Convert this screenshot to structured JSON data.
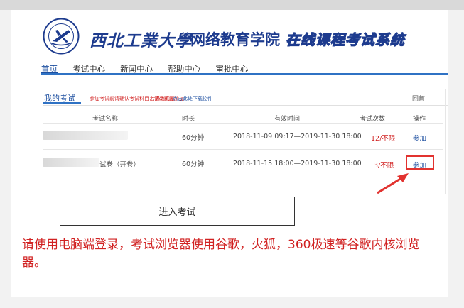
{
  "header": {
    "school_name": "西北工業大學",
    "college_name": "网络教育学院",
    "system_name": "在线课程考试系统"
  },
  "nav": {
    "items": [
      {
        "label": "首页",
        "active": true
      },
      {
        "label": "考试中心",
        "active": false
      },
      {
        "label": "新闻中心",
        "active": false
      },
      {
        "label": "帮助中心",
        "active": false
      },
      {
        "label": "审批中心",
        "active": false
      }
    ]
  },
  "exam_panel": {
    "tab_label": "我的考试",
    "notice_1": "参加考试前请确认考试科目，请勿重复参加",
    "notice_2": "若遇到问题",
    "notice_3": "点击此处下载控件",
    "back_label": "回首",
    "columns": [
      "考试名称",
      "时长",
      "有效时间",
      "考试次数",
      "操作"
    ],
    "rows": [
      {
        "name_suffix": "",
        "duration": "60分钟",
        "valid_period": "2018-11-09 09:17—2019-11-30 18:00",
        "attempts": "12/不限",
        "action": "参加"
      },
      {
        "name_suffix": "试卷（开卷）",
        "duration": "60分钟",
        "valid_period": "2018-11-15 18:00—2019-11-30 18:00",
        "attempts": "3/不限",
        "action": "参加"
      }
    ]
  },
  "enter_button": {
    "label": "进入考试"
  },
  "bottom_notice": "请使用电脑端登录，考试浏览器使用谷歌，火狐，360极速等谷歌内核浏览器。",
  "colors": {
    "brand_blue": "#1d3b8e",
    "link_blue": "#1d4fa0",
    "accent_red": "#d12222",
    "highlight_red": "#e2322f"
  },
  "icons": {
    "emblem": "university-seal-emblem",
    "pointer": "red-arrow-pointer"
  }
}
